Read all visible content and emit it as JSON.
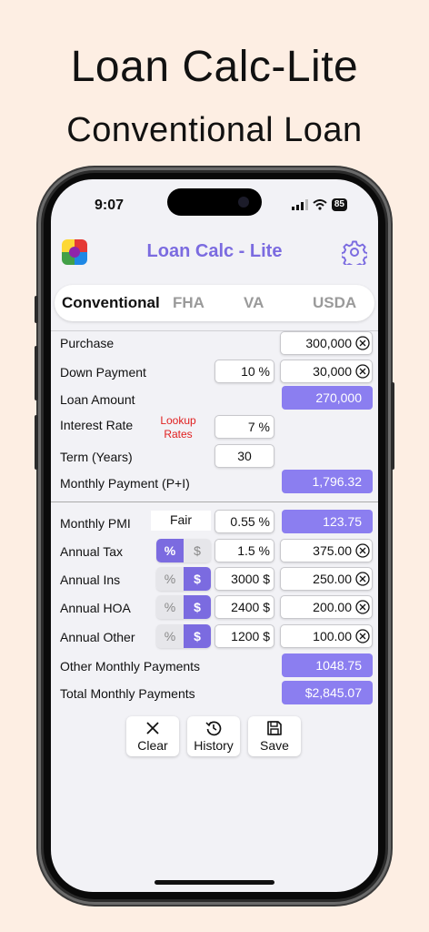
{
  "promo": {
    "title": "Loan Calc-Lite",
    "subtitle": "Conventional Loan"
  },
  "status": {
    "time": "9:07",
    "battery": "85"
  },
  "app": {
    "title": "Loan Calc - Lite"
  },
  "tabs": [
    "Conventional",
    "FHA",
    "VA",
    "USDA"
  ],
  "active_tab": "Conventional",
  "loan": {
    "purchase": {
      "label": "Purchase",
      "value": "300,000"
    },
    "down_payment": {
      "label": "Down Payment",
      "percent": "10 %",
      "value": "30,000"
    },
    "loan_amount": {
      "label": "Loan Amount",
      "value": "270,000"
    },
    "interest_rate": {
      "label": "Interest Rate",
      "lookup": "Lookup Rates",
      "value": "7 %"
    },
    "term": {
      "label": "Term (Years)",
      "value": "30"
    },
    "monthly_payment": {
      "label": "Monthly Payment (P+I)",
      "value": "1,796.32"
    }
  },
  "extras": {
    "pmi": {
      "label": "Monthly PMI",
      "credit": "Fair",
      "rate": "0.55 %",
      "value": "123.75"
    },
    "tax": {
      "label": "Annual Tax",
      "seg_percent": "%",
      "seg_dollar": "$",
      "selected": "%",
      "input": "1.5 %",
      "value": "375.00"
    },
    "ins": {
      "label": "Annual Ins",
      "seg_percent": "%",
      "seg_dollar": "$",
      "selected": "$",
      "input": "3000 $",
      "value": "250.00"
    },
    "hoa": {
      "label": "Annual HOA",
      "seg_percent": "%",
      "seg_dollar": "$",
      "selected": "$",
      "input": "2400 $",
      "value": "200.00"
    },
    "other": {
      "label": "Annual Other",
      "seg_percent": "%",
      "seg_dollar": "$",
      "selected": "$",
      "input": "1200 $",
      "value": "100.00"
    },
    "other_monthly": {
      "label": "Other Monthly Payments",
      "value": "1048.75"
    },
    "total_monthly": {
      "label": "Total Monthly Payments",
      "value": "$2,845.07"
    }
  },
  "actions": {
    "clear": "Clear",
    "history": "History",
    "save": "Save"
  },
  "colors": {
    "accent": "#7b6be0",
    "result_bg": "#8b7ef0",
    "lookup": "#e02020",
    "background": "#fdeee3"
  }
}
